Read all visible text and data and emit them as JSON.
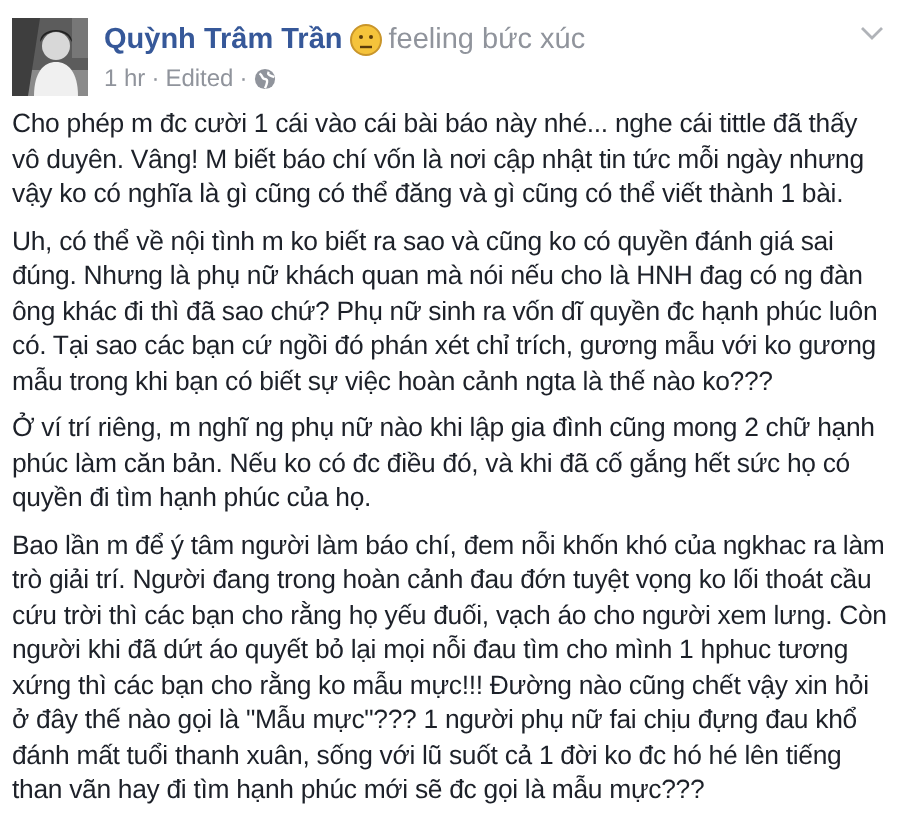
{
  "post": {
    "author": "Quỳnh Trâm Trần",
    "feeling": "feeling bức xúc",
    "meta": [
      "1 hr",
      "·",
      "Edited",
      "·"
    ],
    "paragraphs": [
      "Cho phép m đc cười 1 cái vào cái bài báo này nhé... nghe cái tittle đã thấy vô duyên. Vâng! M biết báo chí vốn là nơi cập nhật tin tức mỗi ngày nhưng vậy ko có nghĩa là gì cũng có thể đăng và gì cũng có thể viết thành 1 bài.",
      "Uh, có thể về nội tình m ko biết ra sao và cũng ko có quyền đánh giá sai đúng. Nhưng là phụ nữ khách quan mà nói nếu cho là HNH đag có ng đàn ông khác đi thì đã sao chứ? Phụ nữ sinh ra vốn dĩ quyền đc hạnh phúc luôn có. Tại sao các bạn cứ ngồi đó phán xét chỉ trích, gương mẫu với ko gương mẫu trong khi bạn có biết sự việc hoàn cảnh ngta là thế nào ko???",
      "Ở ví trí riêng, m nghĩ ng phụ nữ nào khi lập gia đình cũng mong 2 chữ hạnh phúc làm căn bản. Nếu ko có đc điều đó, và khi đã cố gắng hết sức họ có quyền đi tìm hạnh phúc của họ.",
      "Bao lần m để ý tâm người làm báo chí, đem nỗi khốn khó của ngkhac ra làm trò giải trí. Người đang trong hoàn cảnh đau đớn tuyệt vọng ko lối thoát cầu cứu trời thì các bạn cho rằng họ yếu đuối, vạch áo cho người xem lưng. Còn người khi đã dứt áo quyết bỏ lại mọi nỗi đau tìm cho mình 1 hphuc tương xứng thì các bạn cho rằng ko mẫu mực!!! Đường nào cũng chết vậy xin hỏi ở đây thế nào gọi là \"Mẫu mực\"??? 1 người phụ nữ fai chịu đựng đau khổ đánh mất tuổi thanh xuân, sống với lũ suốt cả 1 đời ko đc hó hé lên tiếng than vãn hay đi tìm hạnh phúc mới sẽ đc gọi là mẫu mực???"
    ]
  }
}
